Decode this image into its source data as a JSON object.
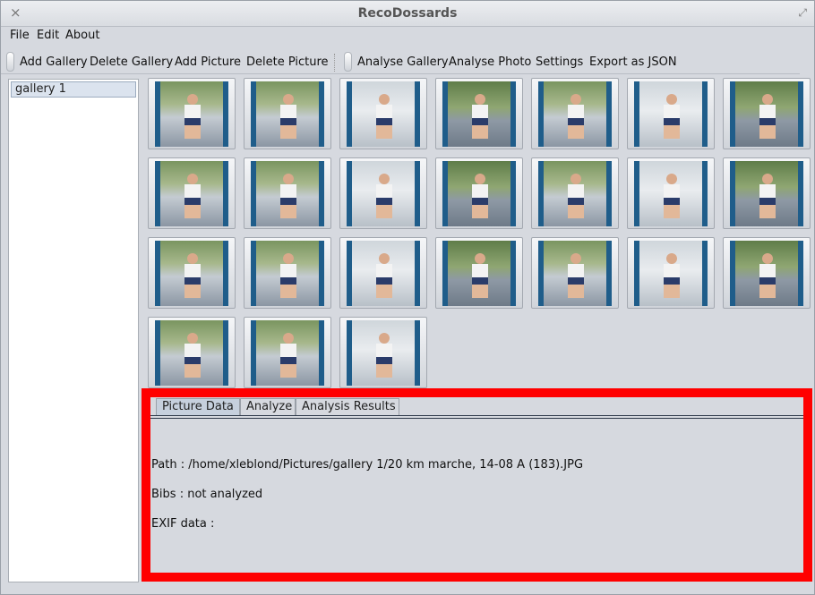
{
  "window": {
    "title": "RecoDossards",
    "close_glyph": "×",
    "maximize_glyph": "⤢"
  },
  "menu": {
    "items": [
      "File",
      "Edit",
      "About"
    ]
  },
  "toolbar": {
    "left_buttons": [
      "Add Gallery",
      "Delete Gallery",
      "Add Picture",
      "Delete Picture"
    ],
    "right_buttons": [
      "Analyse Gallery",
      "Analyse Photo",
      "Settings",
      "Export as JSON"
    ]
  },
  "galleries": {
    "items": [
      "gallery 1"
    ],
    "selected": "gallery 1"
  },
  "thumbnails": {
    "count": 24
  },
  "details": {
    "tabs": [
      "Picture Data",
      "Analyze",
      "Analysis Results"
    ],
    "active_tab": "Picture Data",
    "path_line": "Path : /home/xleblond/Pictures/gallery 1/20 km marche, 14-08 A (183).JPG",
    "bibs_line": "Bibs : not analyzed",
    "exif_line": "EXIF data :"
  },
  "colors": {
    "highlight_border": "#ff0000",
    "window_bg": "#d6d9df",
    "selection_bg": "#dbe3ee"
  }
}
